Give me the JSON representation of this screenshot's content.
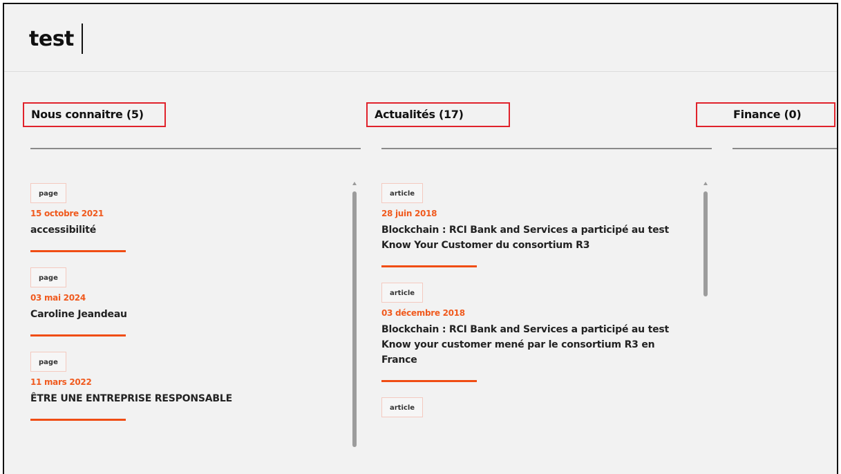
{
  "search": {
    "query": "test"
  },
  "columns": [
    {
      "heading": "Nous connaitre (5)",
      "results": [
        {
          "type": "page",
          "date": "15 octobre 2021",
          "title": "accessibilité"
        },
        {
          "type": "page",
          "date": "03 mai 2024",
          "title": "Caroline Jeandeau"
        },
        {
          "type": "page",
          "date": "11 mars 2022",
          "title": "ÊTRE UNE ENTREPRISE RESPONSABLE"
        }
      ]
    },
    {
      "heading": "Actualités (17)",
      "results": [
        {
          "type": "article",
          "date": "28 juin 2018",
          "title": "Blockchain : RCI Bank and Services a participé au test Know Your Customer du consortium R3"
        },
        {
          "type": "article",
          "date": "03 décembre 2018",
          "title": "Blockchain : RCI Bank and Services a participé au test Know your customer mené par le consortium R3 en France"
        },
        {
          "type": "article",
          "date": "",
          "title": ""
        }
      ]
    },
    {
      "heading": "Finance (0)",
      "results": []
    }
  ],
  "colors": {
    "accent": "#f04d14",
    "date": "#f05a1e",
    "highlight_box": "#e0222b",
    "background": "#f2f2f2"
  }
}
